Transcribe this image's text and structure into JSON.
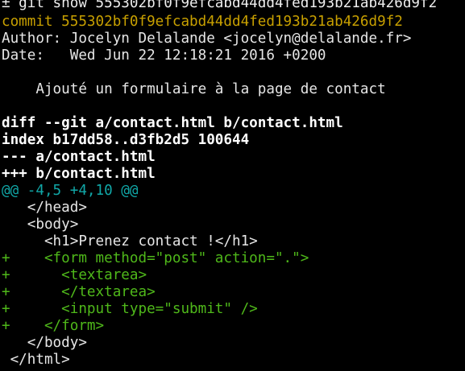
{
  "command_line": "± git show 555302bf0f9efcabd44dd4fed193b21ab426d9f2",
  "commit_line": "commit 555302bf0f9efcabd44dd4fed193b21ab426d9f2",
  "author_line": "Author: Jocelyn Delalande <jocelyn@delalande.fr>",
  "date_line": "Date:   Wed Jun 22 12:18:21 2016 +0200",
  "message_line": "    Ajouté un formulaire à la page de contact",
  "diff_header": {
    "diff_line": "diff --git a/contact.html b/contact.html",
    "index_line": "index b17dd58..d3fb2d5 100644",
    "old_file_line": "--- a/contact.html",
    "new_file_line": "+++ b/contact.html"
  },
  "hunk_line": "@@ -4,5 +4,10 @@",
  "diff_lines": [
    {
      "type": "context",
      "text": "   </head>"
    },
    {
      "type": "context",
      "text": "   <body>"
    },
    {
      "type": "context",
      "text": "     <h1>Prenez contact !</h1>"
    },
    {
      "type": "added",
      "marker": "+",
      "text": "    <form method=\"post\" action=\".\">"
    },
    {
      "type": "added",
      "marker": "+",
      "text": "      <textarea>"
    },
    {
      "type": "added",
      "marker": "+",
      "text": "      </textarea>"
    },
    {
      "type": "added",
      "marker": "+",
      "text": "      <input type=\"submit\" />"
    },
    {
      "type": "added",
      "marker": "+",
      "text": "    </form>"
    },
    {
      "type": "context",
      "text": "   </body>"
    },
    {
      "type": "context",
      "text": " </html>"
    }
  ],
  "colors": {
    "background": "#000000",
    "commit": "#c8a000",
    "hunk": "#11a8a8",
    "added": "#4fb81a",
    "text": "#e6e6e6"
  }
}
